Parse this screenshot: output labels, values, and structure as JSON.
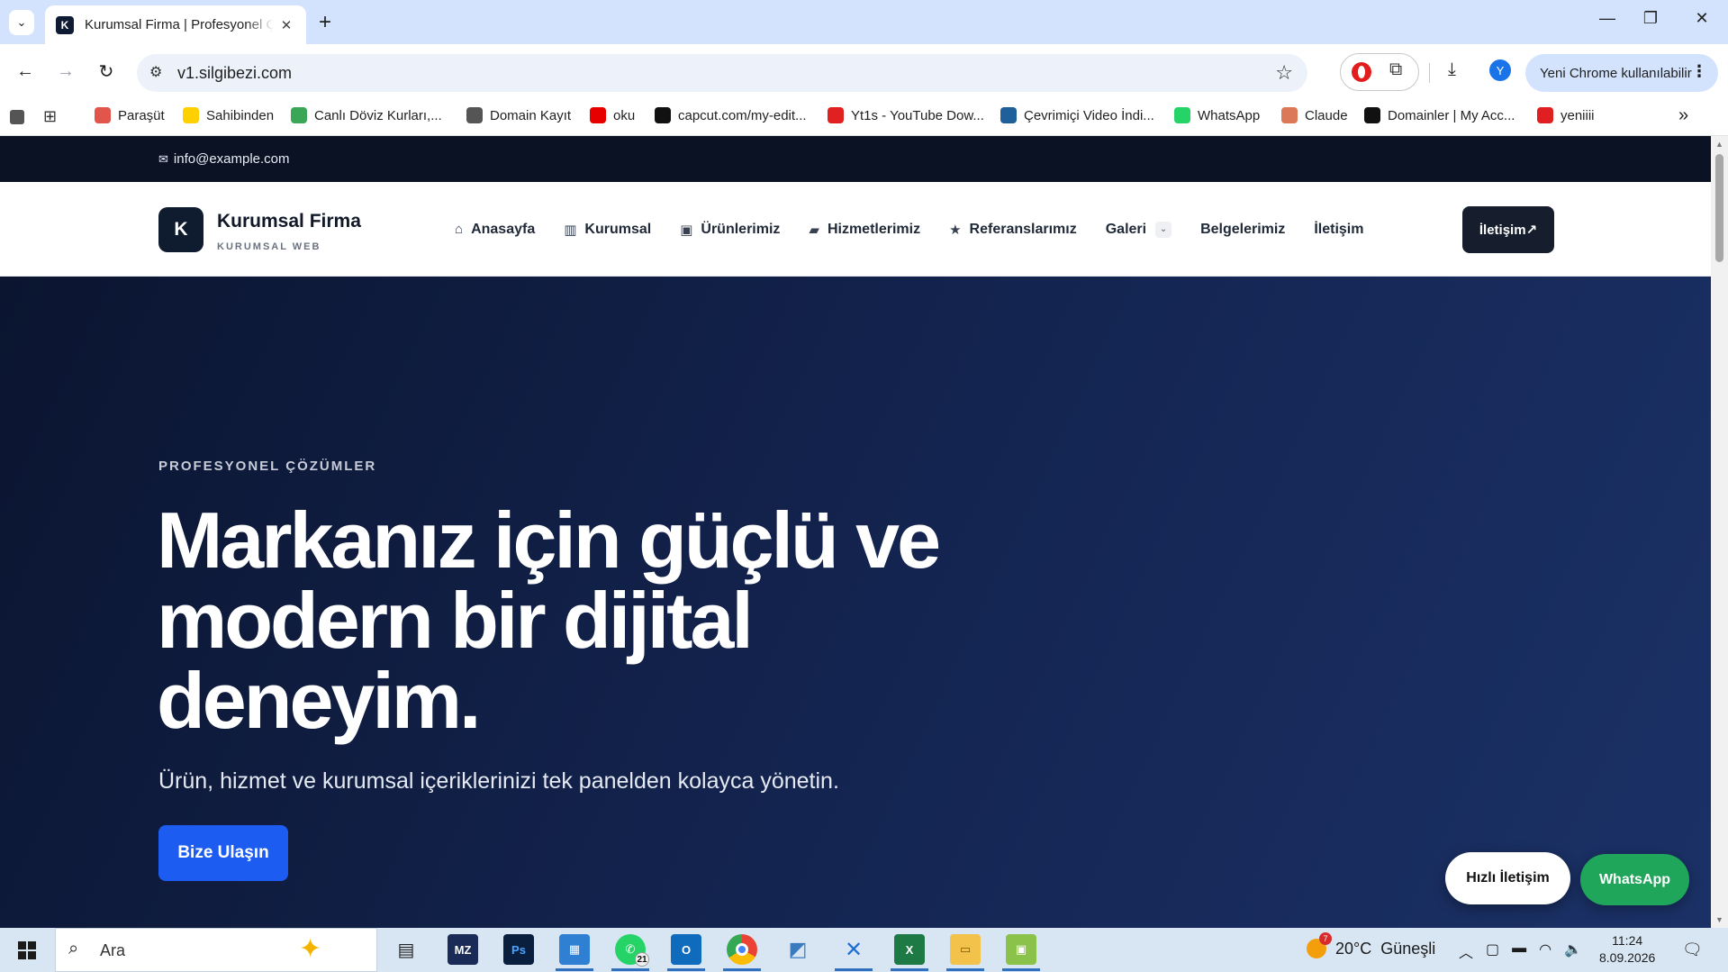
{
  "browser": {
    "tab_title": "Kurumsal Firma | Profesyonel Çözümler",
    "tab_favicon_letter": "K",
    "url": "v1.silgibezi.com",
    "update_label": "Yeni Chrome kullanılabilir",
    "profile_initial": "Y",
    "bookmarks": [
      {
        "label": "Paraşüt",
        "icon": "parasut-icon",
        "color": "#e2554b"
      },
      {
        "label": "Sahibinden",
        "icon": "sahibinden-icon",
        "color": "#ffd000"
      },
      {
        "label": "Canlı Döviz Kurları,...",
        "icon": "doviz-icon",
        "color": "#3aa757"
      },
      {
        "label": "Domain Kayıt",
        "icon": "globe-icon",
        "color": "#555555"
      },
      {
        "label": "oku",
        "icon": "vodafone-icon",
        "color": "#e60000"
      },
      {
        "label": "capcut.com/my-edit...",
        "icon": "capcut-icon",
        "color": "#111111"
      },
      {
        "label": "Yt1s - YouTube Dow...",
        "icon": "yt1s-icon",
        "color": "#e02020"
      },
      {
        "label": "Çevrimiçi Video İndi...",
        "icon": "video-download-icon",
        "color": "#1e5f99"
      },
      {
        "label": "WhatsApp",
        "icon": "whatsapp-icon",
        "color": "#25d366"
      },
      {
        "label": "Claude",
        "icon": "claude-icon",
        "color": "#d97757"
      },
      {
        "label": "Domainler | My Acc...",
        "icon": "wix-icon",
        "color": "#111111"
      },
      {
        "label": "yeniiii",
        "icon": "yeniiii-icon",
        "color": "#e02020"
      }
    ]
  },
  "site": {
    "topbar_email": "info@example.com",
    "logo_letter": "K",
    "logo_name": "Kurumsal Firma",
    "logo_sub": "KURUMSAL WEB",
    "nav": [
      {
        "label": "Anasayfa",
        "icon": "home-icon"
      },
      {
        "label": "Kurumsal",
        "icon": "building-icon"
      },
      {
        "label": "Ürünlerimiz",
        "icon": "box-icon"
      },
      {
        "label": "Hizmetlerimiz",
        "icon": "briefcase-icon"
      },
      {
        "label": "Referanslarımız",
        "icon": "star-icon"
      },
      {
        "label": "Galeri",
        "icon": ""
      },
      {
        "label": "Belgelerimiz",
        "icon": ""
      },
      {
        "label": "İletişim",
        "icon": ""
      }
    ],
    "header_cta": "İletişim↗",
    "hero": {
      "eyebrow": "PROFESYONEL ÇÖZÜMLER",
      "title": "Markanız için güçlü ve modern bir dijital deneyim.",
      "subtitle": "Ürün, hizmet ve kurumsal içeriklerinizi tek panelden kolayca yönetin.",
      "button": "Bize Ulaşın"
    },
    "quick_contact": "Hızlı İletişim",
    "whatsapp": "WhatsApp",
    "colors": {
      "topbar": "#0b1224",
      "hero": "#142552",
      "primary": "#1d5cf0",
      "whatsapp": "#1fa65a"
    }
  },
  "taskbar": {
    "search_placeholder": "Ara",
    "whatsapp_badge": "21",
    "weather_badge": "7",
    "weather": "20°C  Güneşli",
    "time": "11:24",
    "date": "8.09.2026"
  }
}
